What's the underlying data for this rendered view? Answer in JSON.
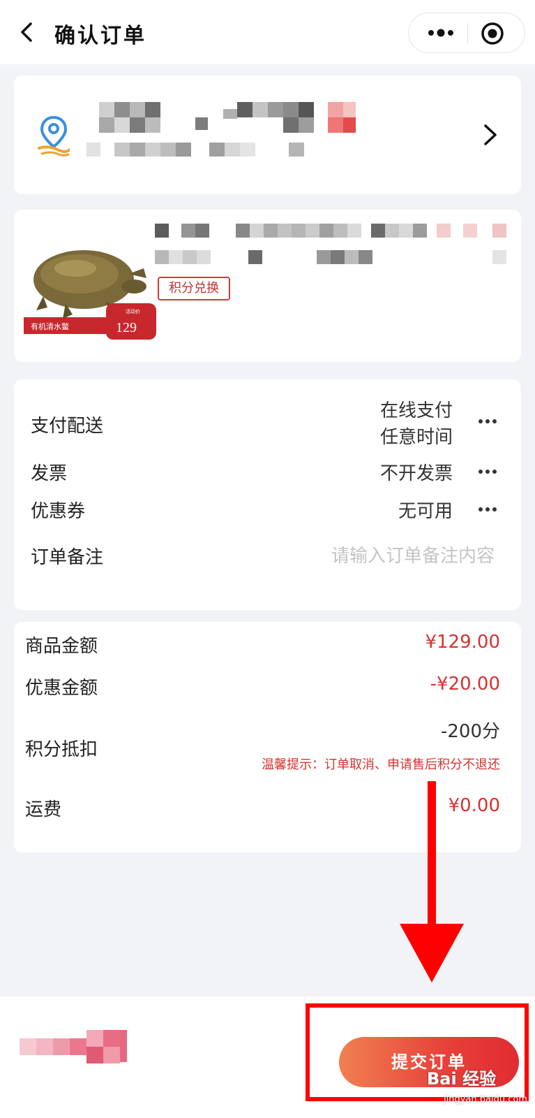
{
  "nav": {
    "title": "确认订单"
  },
  "icons": {
    "back": "chevron-left-icon",
    "more": "more-dots-icon",
    "close": "target-circle-icon",
    "location": "location-pin-icon",
    "arrow": "chevron-right-icon"
  },
  "address": {
    "name_blurred": true,
    "detail_blurred": true
  },
  "product": {
    "tag": "积分兑换",
    "image_banner": "有机清水鳖",
    "image_badge_small": "活动价",
    "image_price": "129"
  },
  "options": {
    "rows": [
      {
        "label": "支付配送",
        "value_line1": "在线支付",
        "value_line2": "任意时间"
      },
      {
        "label": "发票",
        "value": "不开发票"
      },
      {
        "label": "优惠券",
        "value": "无可用"
      },
      {
        "label": "订单备注",
        "placeholder": "请输入订单备注内容"
      }
    ]
  },
  "amounts": {
    "goods_label": "商品金额",
    "goods_value": "¥129.00",
    "discount_label": "优惠金额",
    "discount_value": "-¥20.00",
    "points_label": "积分抵扣",
    "points_value": "-200分",
    "points_tip": "温馨提示：订单取消、申请售后积分不退还",
    "shipping_label": "运费",
    "shipping_value": "¥0.00"
  },
  "bottom": {
    "submit_label": "提交订单",
    "watermark": "Bai 经验",
    "watermark_sub": "jingyan.baidu.com"
  },
  "colors": {
    "accent": "#d5332f",
    "annotation": "#ff0000",
    "background": "#f2f3f7"
  }
}
